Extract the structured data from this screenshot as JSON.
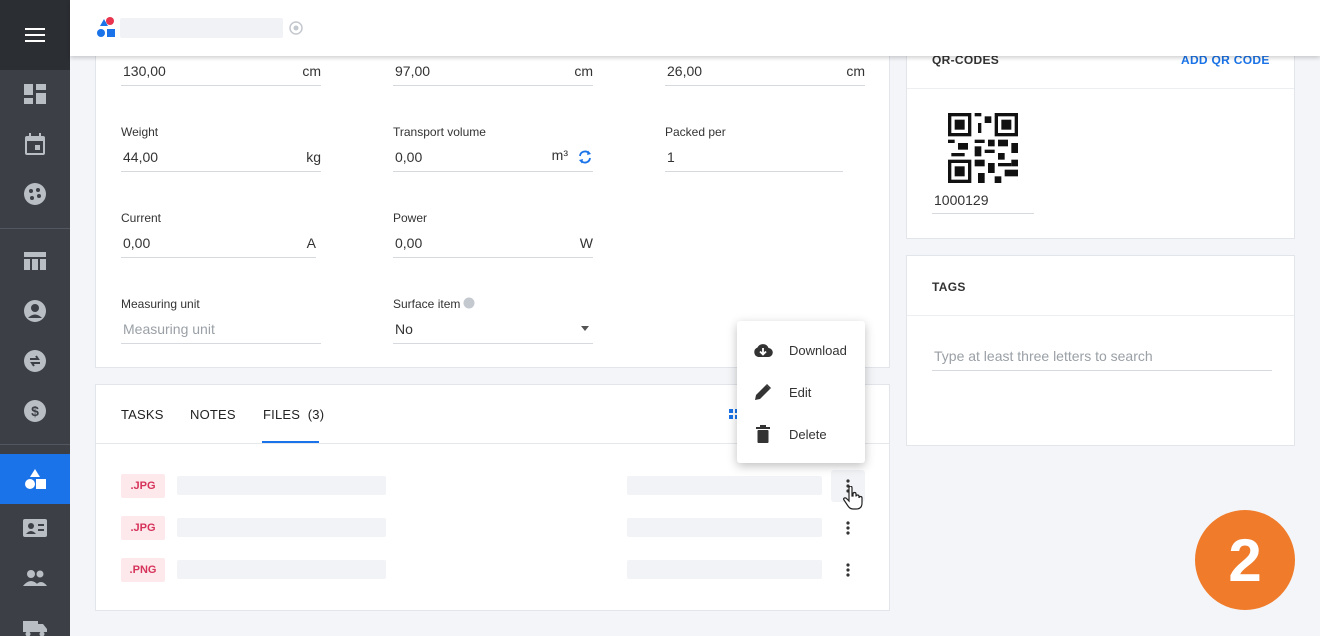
{
  "dimensions": [
    {
      "value": "130,00",
      "unit": "cm"
    },
    {
      "value": "97,00",
      "unit": "cm"
    },
    {
      "value": "26,00",
      "unit": "cm"
    }
  ],
  "fields": {
    "weight": {
      "label": "Weight",
      "value": "44,00",
      "unit": "kg"
    },
    "transport_volume": {
      "label": "Transport volume",
      "value": "0,00",
      "unit": "m³"
    },
    "packed_per": {
      "label": "Packed per",
      "value": "1"
    },
    "current": {
      "label": "Current",
      "value": "0,00",
      "unit": "A"
    },
    "power": {
      "label": "Power",
      "value": "0,00",
      "unit": "W"
    },
    "measuring_unit": {
      "label": "Measuring unit",
      "placeholder": "Measuring unit"
    },
    "surface_item": {
      "label": "Surface item",
      "value": "No"
    }
  },
  "tabs": [
    {
      "label": "TASKS"
    },
    {
      "label": "NOTES"
    },
    {
      "label": "FILES",
      "count": "(3)"
    }
  ],
  "files": [
    {
      "ext": ".JPG"
    },
    {
      "ext": ".JPG"
    },
    {
      "ext": ".PNG"
    }
  ],
  "context_menu": [
    {
      "label": "Download",
      "icon": "cloud-download-icon"
    },
    {
      "label": "Edit",
      "icon": "pencil-icon"
    },
    {
      "label": "Delete",
      "icon": "trash-icon"
    }
  ],
  "qr_codes": {
    "title": "QR-CODES",
    "add_label": "ADD QR CODE",
    "code": "1000129"
  },
  "tags": {
    "title": "TAGS",
    "placeholder": "Type at least three letters to search"
  },
  "step_badge": "2",
  "colors": {
    "accent": "#1a73e8",
    "sidebar": "#3c3f46",
    "badge_text": "#d6335a",
    "step": "#f07b2b"
  }
}
